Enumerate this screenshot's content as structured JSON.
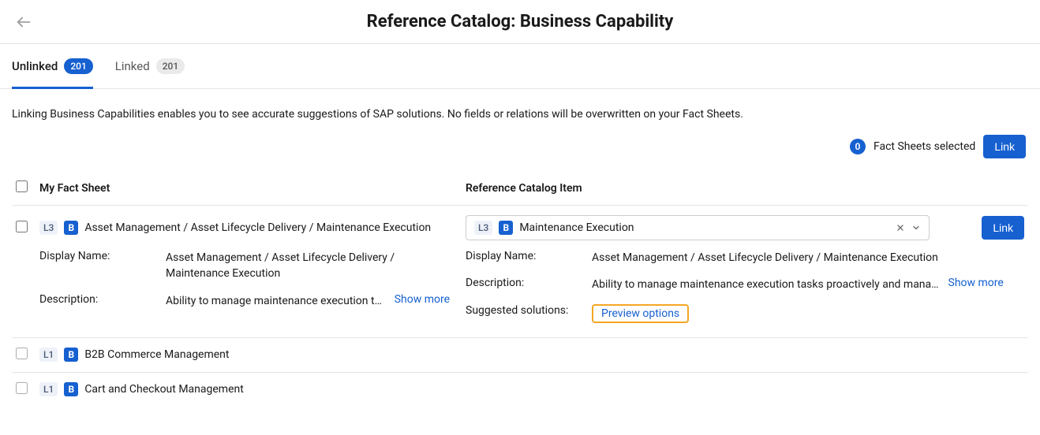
{
  "header": {
    "title": "Reference Catalog: Business Capability"
  },
  "tabs": {
    "unlinked": {
      "label": "Unlinked",
      "count": "201"
    },
    "linked": {
      "label": "Linked",
      "count": "201"
    }
  },
  "info_text": "Linking Business Capabilities enables you to see accurate suggestions of SAP solutions. No fields or relations will be overwritten on your Fact Sheets.",
  "toolbar": {
    "selected_count": "0",
    "selected_label": "Fact Sheets selected",
    "link_button": "Link"
  },
  "columns": {
    "left": "My Fact Sheet",
    "right": "Reference Catalog Item"
  },
  "row_link_button": "Link",
  "row1": {
    "level": "L3",
    "type_chip": "B",
    "fs_name": "Asset Management / Asset Lifecycle Delivery / Maintenance Execution",
    "left": {
      "display_name_label": "Display Name:",
      "display_name_value": "Asset Management / Asset Lifecycle Delivery / Maintenance Execution",
      "description_label": "Description:",
      "description_value": "Ability to manage maintenance execution t…",
      "show_more": "Show more"
    },
    "catalog": {
      "level": "L3",
      "type_chip": "B",
      "selected": "Maintenance Execution"
    },
    "right": {
      "display_name_label": "Display Name:",
      "display_name_value": "Asset Management / Asset Lifecycle Delivery / Maintenance Execution",
      "description_label": "Description:",
      "description_value": "Ability to manage maintenance execution tasks proactively and mana…",
      "show_more": "Show more",
      "suggested_label": "Suggested solutions:",
      "preview_link": "Preview options"
    }
  },
  "row2": {
    "level": "L1",
    "type_chip": "B",
    "fs_name": "B2B Commerce Management"
  },
  "row3": {
    "level": "L1",
    "type_chip": "B",
    "fs_name": "Cart and Checkout Management"
  }
}
